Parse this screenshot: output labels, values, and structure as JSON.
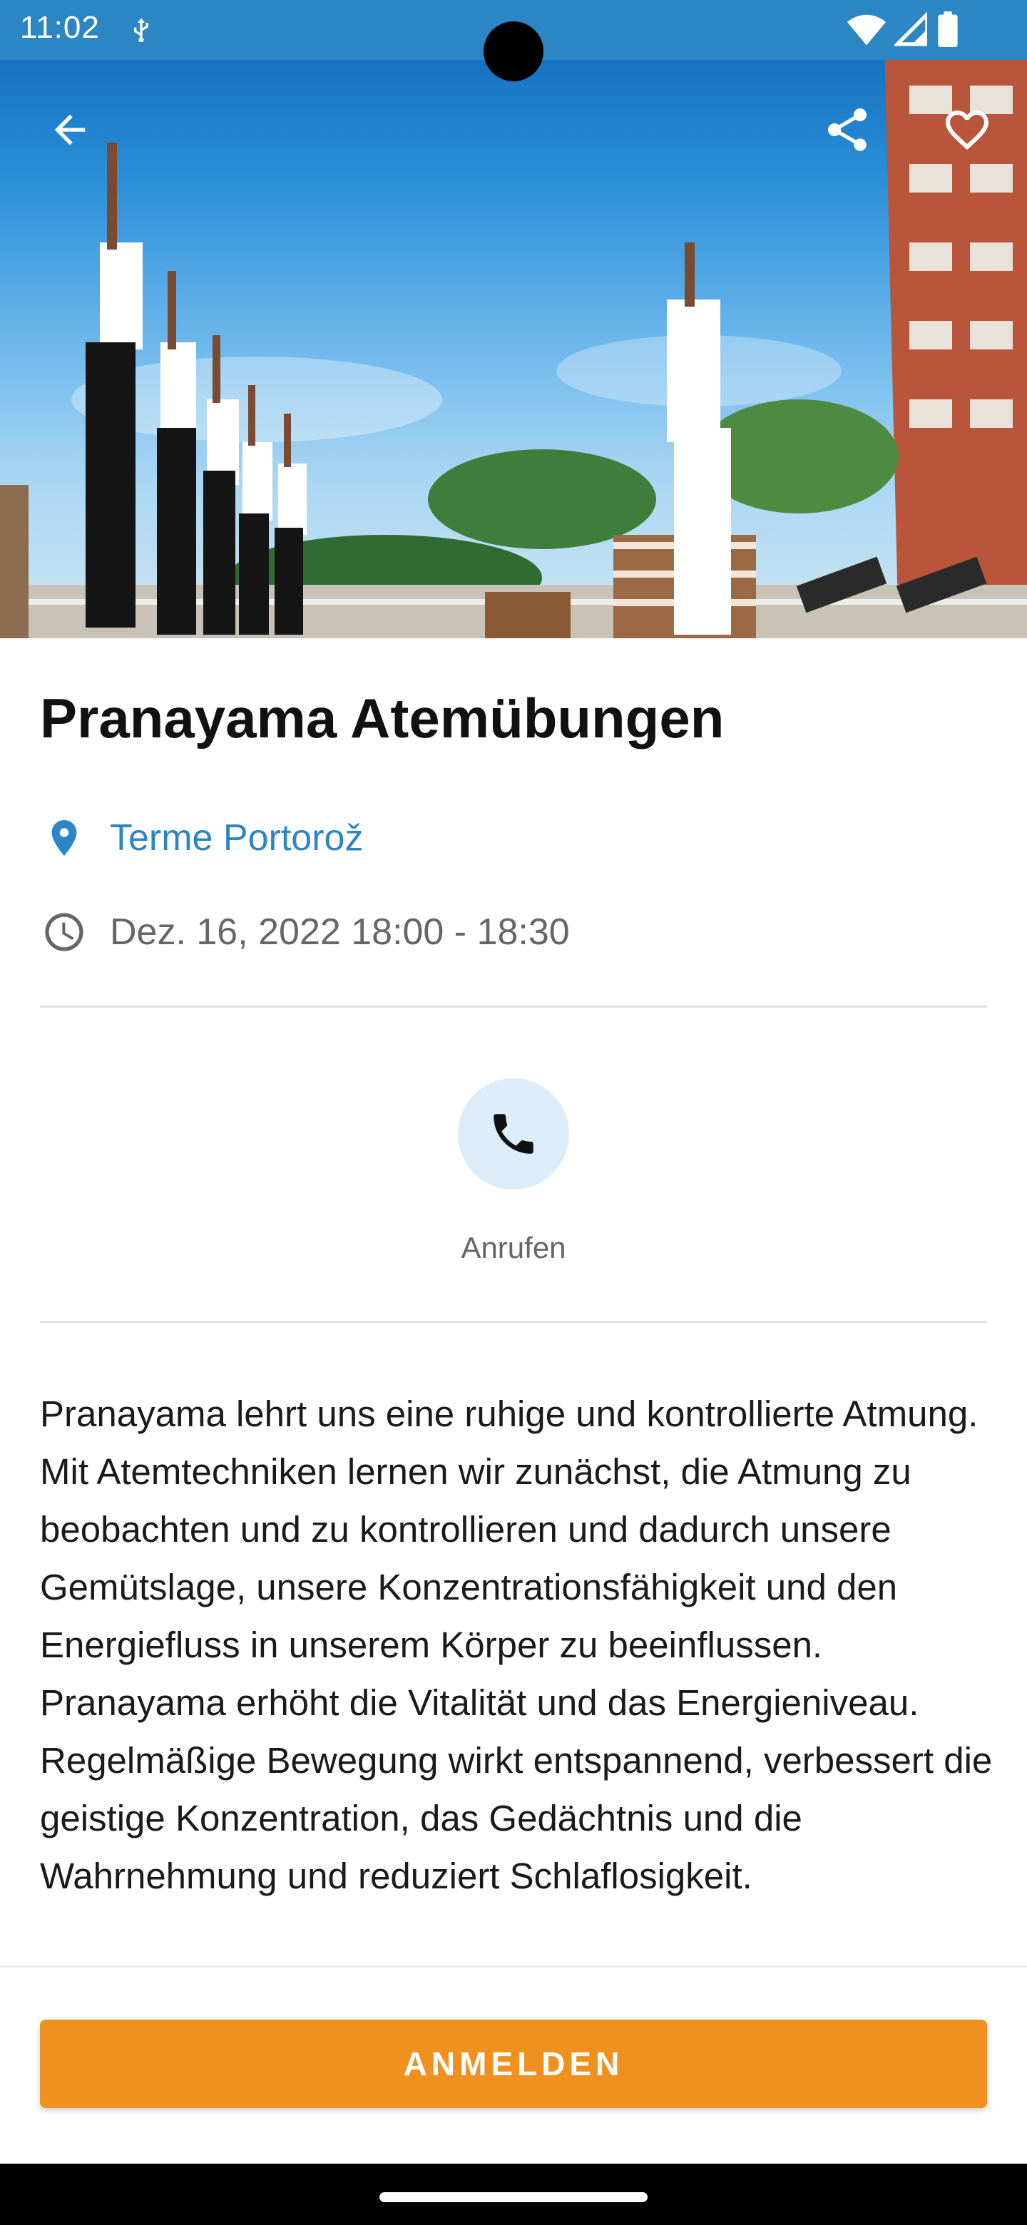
{
  "status_bar": {
    "time": "11:02",
    "icons": [
      "usb-debug-icon",
      "wifi-icon",
      "signal-icon",
      "battery-icon"
    ]
  },
  "app_bar": {
    "back_icon": "arrow-back-icon",
    "share_icon": "share-icon",
    "favorite_icon": "heart-outline-icon"
  },
  "event": {
    "title": "Pranayama Atemübungen",
    "location": "Terme Portorož",
    "datetime": "Dez. 16, 2022 18:00 - 18:30",
    "description": "Pranayama lehrt uns eine ruhige und kontrollierte Atmung. Mit Atemtechniken lernen wir zunächst, die Atmung zu beobachten und zu kontrollieren und dadurch unsere Gemütslage, unsere Konzentrationsfähigkeit und den Energiefluss in unserem Körper zu beeinflussen. Pranayama erhöht die Vitalität und das Energieniveau. Regelmäßige Bewegung wirkt entspannend, verbessert die geistige Konzentration, das Gedächtnis und die Wahrnehmung und reduziert Schlaflosigkeit."
  },
  "actions": {
    "call_label": "Anrufen",
    "register_label": "ANMELDEN"
  },
  "colors": {
    "accent_blue": "#2b86c3",
    "cta_orange": "#f0901f",
    "call_bg": "#dcecf8"
  }
}
